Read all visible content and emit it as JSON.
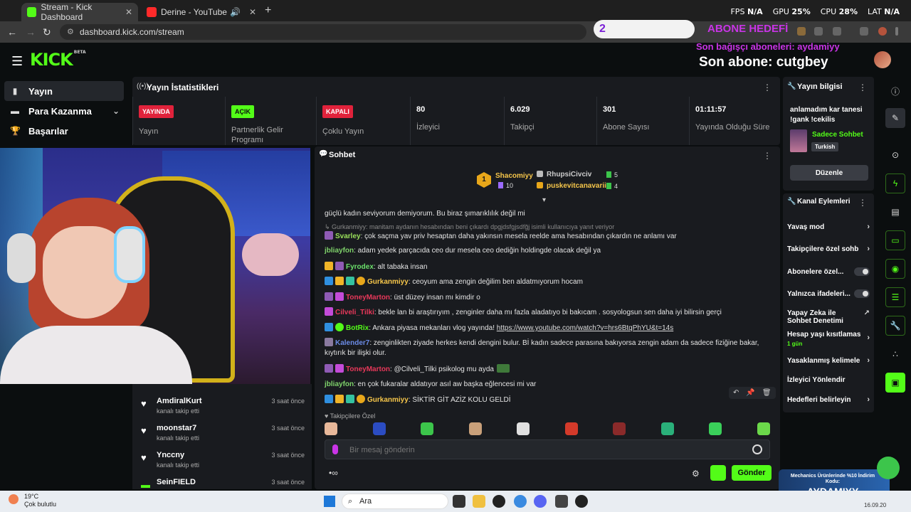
{
  "browser": {
    "tabs": [
      {
        "title": "Stream - Kick Dashboard",
        "active": true
      },
      {
        "title": "Derine - YouTube",
        "active": false
      }
    ],
    "url": "dashboard.kick.com/stream",
    "sys": {
      "fps_label": "FPS",
      "fps_val": "N/A",
      "gpu_label": "GPU",
      "gpu_val": "25",
      "cpu_label": "CPU",
      "cpu_val": "28",
      "lat_label": "LAT",
      "lat_val": "N/A"
    }
  },
  "overlay": {
    "sub_goal_count": "2",
    "sub_goal_label": "ABONE HEDEFİ",
    "last_donor_subs": "Son bağışçı aboneleri: aydamiyy",
    "last_sub": "Son abone: cutgbey",
    "promo_small": "Mechanics Ürünlerinde %10 İndirim Kodu:",
    "promo_big": "AYDAMIYY"
  },
  "kick": {
    "logo": "KICK",
    "beta": "BETA"
  },
  "sidebar": {
    "items": [
      {
        "label": "Yayın",
        "active": true
      },
      {
        "label": "Para Kazanma"
      },
      {
        "label": "Başarılar"
      }
    ]
  },
  "stats": {
    "title": "Yayın İstatistikleri",
    "cells": [
      {
        "badge": "YAYINDA",
        "label": "Yayın"
      },
      {
        "badge": "AÇIK",
        "label": "Partnerlik Gelir Programı"
      },
      {
        "badge": "KAPALI",
        "label": "Çoklu Yayın"
      },
      {
        "value": "80",
        "label": "İzleyici"
      },
      {
        "value": "6.029",
        "label": "Takipçi"
      },
      {
        "value": "301",
        "label": "Abone Sayısı"
      },
      {
        "value": "01:11:57",
        "label": "Yayında Olduğu Süre"
      }
    ]
  },
  "follows": [
    {
      "name": "AmdiralKurt",
      "sub": "kanalı takip etti",
      "time": "3 saat önce"
    },
    {
      "name": "moonstar7",
      "sub": "kanalı takip etti",
      "time": "3 saat önce"
    },
    {
      "name": "Ynccny",
      "sub": "kanalı takip etti",
      "time": "3 saat önce"
    },
    {
      "name": "SeinFIELD",
      "sub": "",
      "time": "3 saat önce"
    }
  ],
  "chat": {
    "title": "Sohbet",
    "gifters": {
      "top": {
        "name": "Shacomiyy",
        "count": "10",
        "rank": "1"
      },
      "second": {
        "name": "RhupsiCivciv",
        "count": "5"
      },
      "third": {
        "name": "puskevitcanavarii",
        "count": "4"
      }
    },
    "messages": [
      {
        "user": "",
        "text": "güçlü kadın seviyorum demiyorum. Bu biraz şımarıklılık değil mi"
      },
      {
        "user": "",
        "text": "↳ Gurkanmiyy: manitam aydanın hesabından beni çıkardı dpgjdsfgjsdfğj isimli kullanıcıya yanıt veriyor",
        "reply": true
      },
      {
        "user": "Svarley",
        "text": ": çok saçma yav priv hesaptan daha yakınsın mesela reelde ama hesabından çıkardın ne anlamı var"
      },
      {
        "user": "jbliayfon",
        "text": ": adam yedek parçacıda ceo dur mesela ceo dediğin holdingde olacak değil ya"
      },
      {
        "user": "Fyrodex",
        "text": ": alt tabaka insan"
      },
      {
        "user": "Gurkanmiyy",
        "text": ": ceoyum ama zengin değilim ben aldatmıyorum hocam"
      },
      {
        "user": "ToneyMarton",
        "text": ": üst düzey insan mı kimdir o"
      },
      {
        "user": "Cilveli_Tilki",
        "text": ": bekle lan bi araştırıyım , zenginler daha mı fazla aladatıyo bi bakıcam . sosyologsun sen daha iyi bilirsin gerçi"
      },
      {
        "user": "BotRix",
        "text": ": Ankara piyasa mekanları vlog yayında! ",
        "link": "https://www.youtube.com/watch?v=hrs6BtqPhYU&t=14s"
      },
      {
        "user": "Kalender7",
        "text": ": zenginlikten ziyade herkes kendi dengini bulur. Bİ kadın sadece parasına bakıyorsa zengin adam da sadece fiziğine bakar, kıytırık bir ilişki olur."
      },
      {
        "user": "ToneyMarton",
        "text": ": @Cilveli_Tilki psikolog mu ayda"
      },
      {
        "user": "jbliayfon",
        "text": ": en çok fukaralar aldatıyor asıl aw başka eğlencesi mi var"
      },
      {
        "user": "Gurkanmiyy",
        "text": ": SİKTİR GİT AZİZ KOLU GELDİ"
      }
    ],
    "followers_only": "♥ Takipçilere Özel",
    "input_placeholder": "Bir mesaj gönderin",
    "send": "Gönder"
  },
  "stream_info": {
    "title": "Yayın bilgisi",
    "description": "anlamadım kar tanesi !gank !cekilis",
    "category": "Sadece Sohbet",
    "language": "Turkish",
    "edit": "Düzenle"
  },
  "channel_actions": {
    "title": "Kanal Eylemleri",
    "items": [
      {
        "label": "Yavaş mod"
      },
      {
        "label": "Takipçilere özel sohb"
      },
      {
        "label": "Abonelere özel..."
      },
      {
        "label": "Yalnızca ifadeleri..."
      },
      {
        "label": "Yapay Zeka ile Sohbet Denetimi"
      },
      {
        "label": "Hesap yaşı kısıtlamas",
        "sub": "1 gün"
      },
      {
        "label": "Yasaklanmış kelimele"
      },
      {
        "label": "İzleyici Yönlendir"
      },
      {
        "label": "Hedefleri belirleyin"
      }
    ]
  },
  "taskbar": {
    "temp": "19°C",
    "cond": "Çok bulutlu",
    "search": "Ara",
    "date": "16.09.20"
  },
  "colors": {
    "kick_green": "#53fc18",
    "live_red": "#e0223b",
    "overlay_purple": "#c934e6",
    "panel": "#191b1f"
  }
}
